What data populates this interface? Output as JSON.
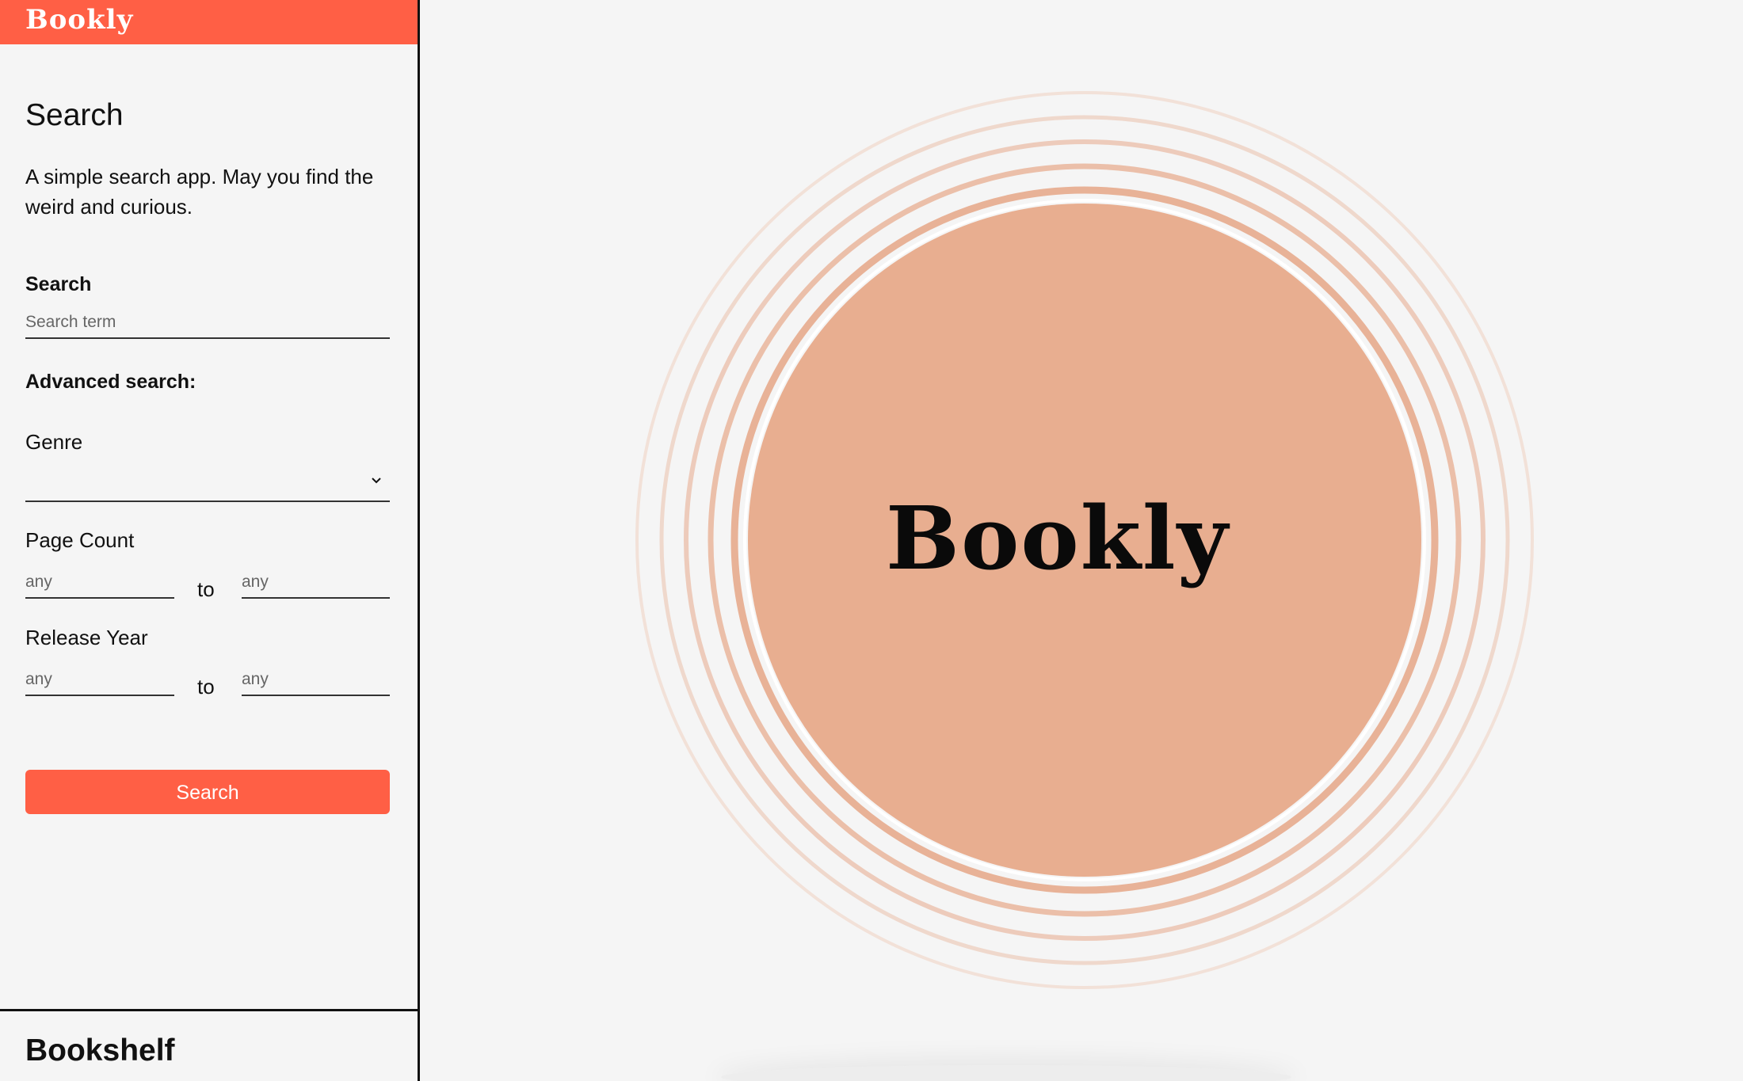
{
  "brand": {
    "name": "Bookly"
  },
  "search_panel": {
    "heading": "Search",
    "description": "A simple search app. May you find the weird and curious.",
    "search_label": "Search",
    "search_placeholder": "Search term",
    "advanced_label": "Advanced search:",
    "genre_label": "Genre",
    "genre_value": "",
    "page_count_label": "Page Count",
    "page_count_from_placeholder": "any",
    "page_count_to_placeholder": "any",
    "release_year_label": "Release Year",
    "release_year_from_placeholder": "any",
    "release_year_to_placeholder": "any",
    "range_separator": "to",
    "submit_label": "Search"
  },
  "bookshelf": {
    "heading": "Bookshelf"
  },
  "hero": {
    "title": "Bookly"
  },
  "colors": {
    "accent": "#ff5f45",
    "circle_fill": "#e8ae90",
    "ring": "#e6a98c",
    "background": "#f5f5f5"
  },
  "icons": {
    "genre_dropdown": "chevron-down-icon"
  }
}
